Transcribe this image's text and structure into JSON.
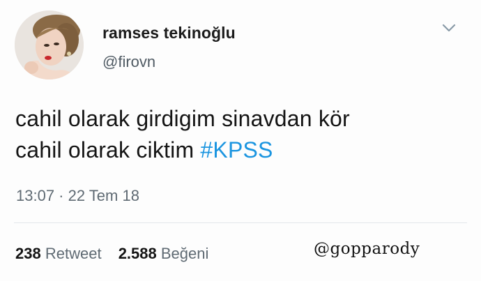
{
  "tweet": {
    "author": {
      "display_name": "ramses tekinoğlu",
      "handle": "@firovn"
    },
    "text_line_1": "cahil olarak girdigim sinavdan kör",
    "text_line_2_plain": "cahil olarak ciktim ",
    "hashtag": "#KPSS",
    "timestamp": "13:07 · 22 Tem 18",
    "stats": {
      "retweet_count": "238",
      "retweet_label": "Retweet",
      "like_count": "2.588",
      "like_label": "Beğeni"
    },
    "menu_icon": "chevron-down-icon",
    "hashtag_color": "#1b95e0"
  },
  "watermark": "@gopparody"
}
